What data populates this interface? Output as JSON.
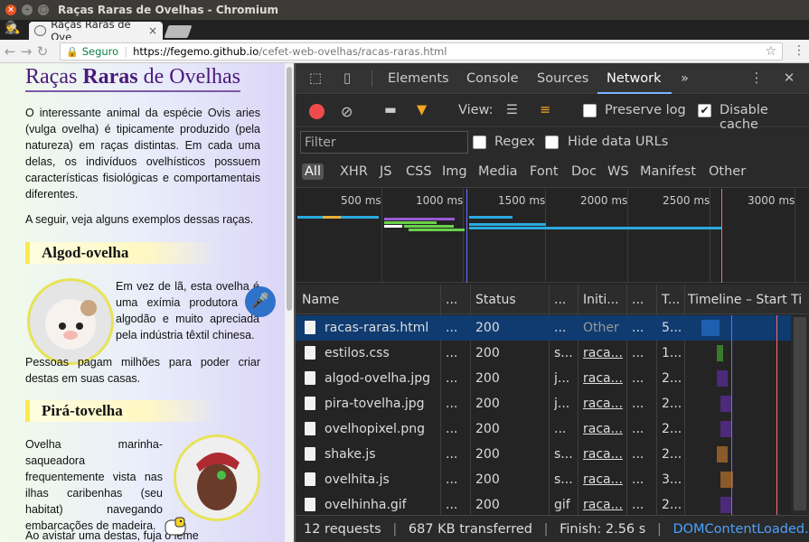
{
  "window": {
    "title": "Raças Raras de Ovelhas - Chromium"
  },
  "tab": {
    "title": "Raças Raras de Ove",
    "close": "×"
  },
  "address": {
    "secure_label": "Seguro",
    "url_host": "https://fegemo.github.io",
    "url_path": "/cefet-web-ovelhas/racas-raras.html"
  },
  "page": {
    "title_pre": "Raças ",
    "title_bold": "Raras",
    "title_post": " de Ovelhas",
    "intro": "O interessante animal da espécie Ovis aries (vulga ovelha) é tipicamente produzido (pela natureza) em raças distintas. Em cada uma delas, os indivíduos ovelhísticos possuem características fisiológicas e comportamentais diferentes.",
    "intro2": "A seguir, veja alguns exemplos dessas raças.",
    "sec1": "Algod-ovelha",
    "sec1_text": "Em vez de lã, esta ovelha é uma exímia produtora de algodão e muito apreciada pela indústria têxtil chinesa.",
    "sec1_text2": "Pessoas pagam milhões para poder criar destas em suas casas.",
    "sec2": "Pirá-tovelha",
    "sec2_text": "Ovelha marinha-saqueadora frequentemente vista nas ilhas caribenhas (seu habitat) navegando embarcações de madeira.",
    "sec2_text2": "Ao avistar uma destas, fuja o leme"
  },
  "devtools": {
    "tabs": [
      "Elements",
      "Console",
      "Sources",
      "Network"
    ],
    "more": "»",
    "view_label": "View:",
    "preserve_log": "Preserve log",
    "disable_cache": "Disable cache",
    "filter_placeholder": "Filter",
    "regex": "Regex",
    "hide_data_urls": "Hide data URLs",
    "types": [
      "All",
      "XHR",
      "JS",
      "CSS",
      "Img",
      "Media",
      "Font",
      "Doc",
      "WS",
      "Manifest",
      "Other"
    ],
    "ticks": [
      "500 ms",
      "1000 ms",
      "1500 ms",
      "2000 ms",
      "2500 ms",
      "3000 ms"
    ],
    "columns": [
      "Name",
      "...",
      "Status",
      "...",
      "Initi...",
      "...",
      "T...",
      "Timeline – Start Ti"
    ],
    "rows": [
      {
        "name": "racas-raras.html",
        "a": "...",
        "status": "200",
        "b": "...",
        "init": "Other",
        "c": "...",
        "t": "5..."
      },
      {
        "name": "estilos.css",
        "a": "...",
        "status": "200",
        "b": "s...",
        "init": "raca...",
        "c": "...",
        "t": "1..."
      },
      {
        "name": "algod-ovelha.jpg",
        "a": "...",
        "status": "200",
        "b": "j...",
        "init": "raca...",
        "c": "...",
        "t": "2..."
      },
      {
        "name": "pira-tovelha.jpg",
        "a": "...",
        "status": "200",
        "b": "j...",
        "init": "raca...",
        "c": "...",
        "t": "2..."
      },
      {
        "name": "ovelhopixel.png",
        "a": "...",
        "status": "200",
        "b": "...",
        "init": "raca...",
        "c": "...",
        "t": "2..."
      },
      {
        "name": "shake.js",
        "a": "...",
        "status": "200",
        "b": "s...",
        "init": "raca...",
        "c": "...",
        "t": "2..."
      },
      {
        "name": "ovelhita.js",
        "a": "...",
        "status": "200",
        "b": "s...",
        "init": "raca...",
        "c": "...",
        "t": "3..."
      },
      {
        "name": "ovelhinha.gif",
        "a": "...",
        "status": "200",
        "b": "gif",
        "init": "raca...",
        "c": "...",
        "t": "2..."
      }
    ],
    "status_requests": "12 requests",
    "status_transferred": "687 KB transferred",
    "status_finish": "Finish: 2.56 s",
    "status_dcl": "DOMContentLoaded..."
  },
  "colors": {
    "accent": "#7eb3ff",
    "record": "#ef4b4b",
    "selected_row": "#0f3b70"
  }
}
